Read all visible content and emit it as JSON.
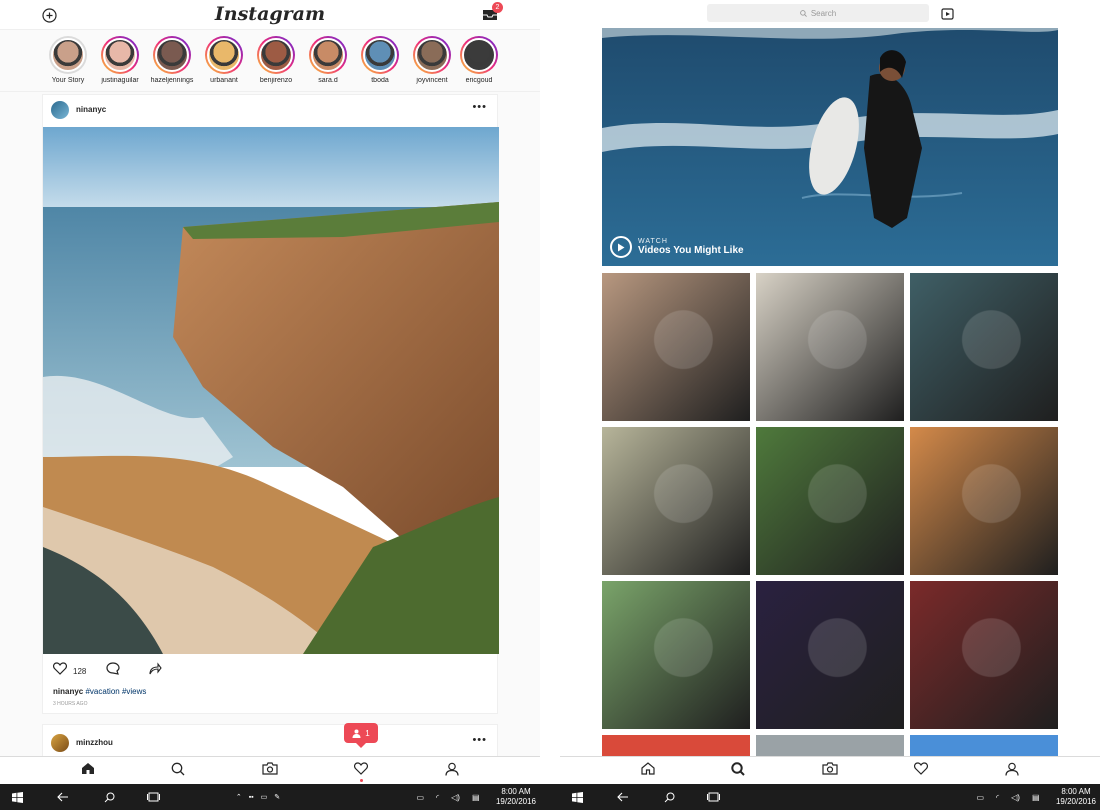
{
  "left_app": {
    "logo_text": "Instagram",
    "inbox_badge": "2",
    "stories": [
      {
        "name": "Your Story",
        "seen": true,
        "color": "#c9a08a"
      },
      {
        "name": "justinaguilar",
        "seen": false,
        "color": "#e7b8a8"
      },
      {
        "name": "hazeljennings",
        "seen": false,
        "color": "#7a5a50"
      },
      {
        "name": "urbanant",
        "seen": false,
        "color": "#e9b86a"
      },
      {
        "name": "benjirenzo",
        "seen": false,
        "color": "#9d5b44"
      },
      {
        "name": "sara.d",
        "seen": false,
        "color": "#c88b66"
      },
      {
        "name": "tboda",
        "seen": false,
        "color": "#5f8fb6"
      },
      {
        "name": "joyvincent",
        "seen": false,
        "color": "#8a6c58"
      },
      {
        "name": "ericgoud",
        "seen": false,
        "color": "#3b3b3b"
      }
    ],
    "post": {
      "username": "ninanyc",
      "likes": "128",
      "caption_user": "ninanyc",
      "caption_tags": "#vacation #views",
      "time_ago": "3 HOURS AGO"
    },
    "next_post": {
      "username": "minzzhou"
    },
    "notification_count": "1",
    "tabs": [
      "home-icon",
      "search-icon",
      "camera-icon",
      "heart-icon",
      "profile-icon"
    ],
    "active_tab": "home"
  },
  "right_app": {
    "search_placeholder": "Search",
    "video": {
      "label": "WATCH",
      "title": "Videos You Might Like"
    },
    "tiles": [
      {
        "name": "dog",
        "color": "#b89880"
      },
      {
        "name": "sketchbook",
        "color": "#d8d2c6"
      },
      {
        "name": "man-window",
        "color": "#3f5f66"
      },
      {
        "name": "road-helmet",
        "color": "#b7b59a"
      },
      {
        "name": "leaves",
        "color": "#4f7a3c"
      },
      {
        "name": "sunset-couple",
        "color": "#d48a4a"
      },
      {
        "name": "beach-path",
        "color": "#7aa46a"
      },
      {
        "name": "fireworks",
        "color": "#2a2140"
      },
      {
        "name": "flowers",
        "color": "#7b2a2a"
      }
    ],
    "active_tab": "search"
  },
  "taskbar": {
    "left_time": "8:00 AM",
    "left_date": "19/20/2016",
    "right_time": "8:00 AM",
    "right_date": "19/20/2016"
  }
}
